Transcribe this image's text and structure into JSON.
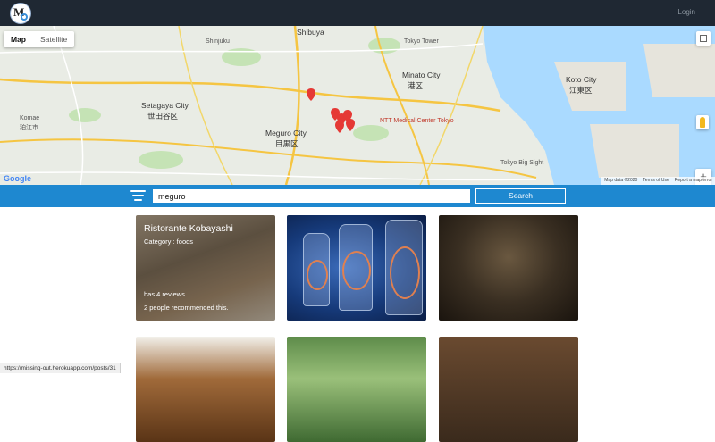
{
  "header": {
    "logo": "MO",
    "login_label": "Login"
  },
  "map": {
    "type_controls": [
      "Map",
      "Satellite"
    ],
    "labels": [
      "Shibuya",
      "Minato City",
      "港区",
      "Setagaya City",
      "世田谷区",
      "Meguro City",
      "目黒区",
      "Koto City",
      "江東区",
      "Komae",
      "狛江市",
      "Shinjuku",
      "Tokyo Tower",
      "NTT Medical Center Tokyo",
      "Tokyo Big Sight"
    ],
    "footer": [
      "Map data ©2020",
      "Terms of Use",
      "Report a map error"
    ],
    "google_logo": "Google",
    "zoom_in": "+",
    "zoom_out": "−"
  },
  "search": {
    "value": "meguro",
    "button_label": "Search"
  },
  "cards": [
    {
      "title": "Ristorante Kobayashi",
      "category": "Category  : foods",
      "reviews": "has 4 reviews.",
      "recommend": "2 people recommended this."
    }
  ],
  "status_url": "https://missing-out.herokuapp.com/posts/31"
}
